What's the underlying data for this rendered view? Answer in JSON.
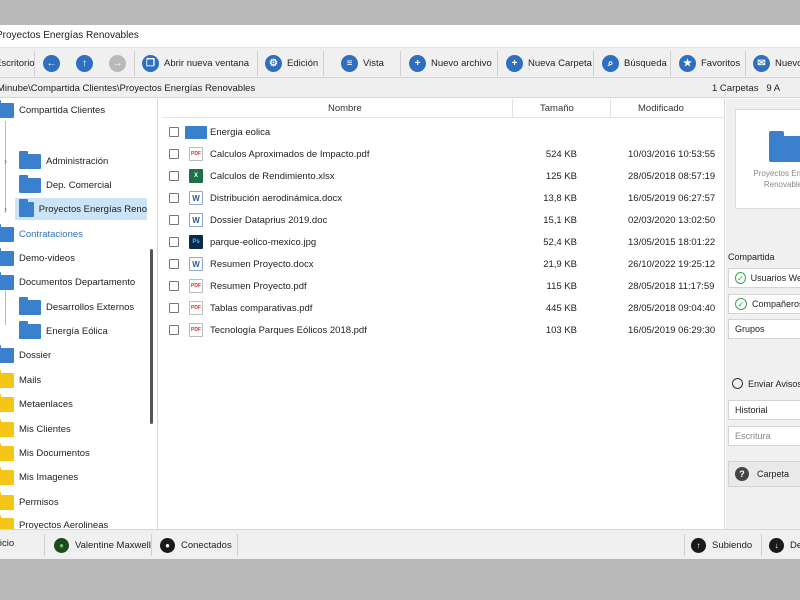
{
  "window": {
    "title": "Proyectos Energías Renovables"
  },
  "toolbar": {
    "escritorio": "Escritorio",
    "back_icon": "arrow-left-icon",
    "up_icon": "arrow-up-icon",
    "forward_icon": "arrow-right-icon",
    "abrir": "Abrir nueva ventana",
    "edicion": "Edición",
    "vista": "Vista",
    "nuevo_archivo": "Nuevo archivo",
    "nueva_carpeta": "Nueva Carpeta",
    "busqueda": "Búsqueda",
    "favoritos": "Favoritos",
    "nuevo": "Nuevo"
  },
  "path": {
    "text": "Minube\\Compartida Clientes\\Proyectos Energías Renovables",
    "count": "1 Carpetas",
    "count_extra": "9 A"
  },
  "tree": [
    {
      "label": "Compartida Clientes"
    },
    {
      "label": "Administración"
    },
    {
      "label": "Dep. Comercial"
    },
    {
      "label": "Proyectos Energías Reno"
    },
    {
      "label": "Contrataciones"
    },
    {
      "label": "Demo-videos"
    },
    {
      "label": "Documentos Departamento"
    },
    {
      "label": "Desarrollos Externos"
    },
    {
      "label": "Energía Eólica"
    },
    {
      "label": "Dossier"
    },
    {
      "label": "Mails"
    },
    {
      "label": "Metaenlaces"
    },
    {
      "label": "Mis Clientes"
    },
    {
      "label": "Mis Documentos"
    },
    {
      "label": "Mis Imagenes"
    },
    {
      "label": "Permisos"
    },
    {
      "label": "Proyectos Aerolineas"
    }
  ],
  "filelist": {
    "headers": {
      "name": "Nombre",
      "size": "Tamaño",
      "modified": "Modificado"
    },
    "rows": [
      {
        "type": "folder",
        "name": "Energia eolica",
        "size": "",
        "modified": ""
      },
      {
        "type": "pdf",
        "name": "Calculos Aproximados de Impacto.pdf",
        "size": "524 KB",
        "modified": "10/03/2016 10:53:55"
      },
      {
        "type": "xls",
        "name": "Calculos de Rendimiento.xlsx",
        "size": "125 KB",
        "modified": "28/05/2018 08:57:19"
      },
      {
        "type": "doc",
        "name": "Distribución aerodinámica.docx",
        "size": "13,8 KB",
        "modified": "16/05/2019 06:27:57"
      },
      {
        "type": "doc",
        "name": "Dossier Dataprius 2019.doc",
        "size": "15,1 KB",
        "modified": "02/03/2020 13:02:50"
      },
      {
        "type": "ps",
        "name": "parque-eolico-mexico.jpg",
        "size": "52,4 KB",
        "modified": "13/05/2015 18:01:22"
      },
      {
        "type": "doc",
        "name": "Resumen Proyecto.docx",
        "size": "21,9 KB",
        "modified": "26/10/2022 19:25:12"
      },
      {
        "type": "pdf",
        "name": "Resumen Proyecto.pdf",
        "size": "115 KB",
        "modified": "28/05/2018 11:17:59"
      },
      {
        "type": "pdf",
        "name": "Tablas comparativas.pdf",
        "size": "445 KB",
        "modified": "28/05/2018 09:04:40"
      },
      {
        "type": "pdf",
        "name": "Tecnología Parques Eólicos 2018.pdf",
        "size": "103 KB",
        "modified": "16/05/2019 06:29:30"
      }
    ],
    "icon_labels": {
      "pdf": "PDF",
      "xls": "X",
      "doc": "W",
      "ps": "Ps",
      "folder": ""
    }
  },
  "rpanel": {
    "preview_title_line1": "Proyectos Energ",
    "preview_title_line2": "Renovable",
    "compartida": "Compartida",
    "usuarios": "Usuarios Web",
    "companeros": "Compañeros",
    "grupos": "Grupos",
    "enviar_avisos": "Enviar Avisos",
    "historial": "Historial",
    "escritura": "Escritura",
    "help": "Carpeta"
  },
  "statusbar": {
    "inicio": "Inicio",
    "user": "Valentine Maxwell",
    "conectados": "Conectados",
    "subiendo": "Subiendo",
    "descargando": "De"
  },
  "colors": {
    "accent": "#2f6fc0",
    "folder_blue": "#3a80cc",
    "folder_yellow": "#f5c518",
    "selection": "#cce4f7"
  }
}
